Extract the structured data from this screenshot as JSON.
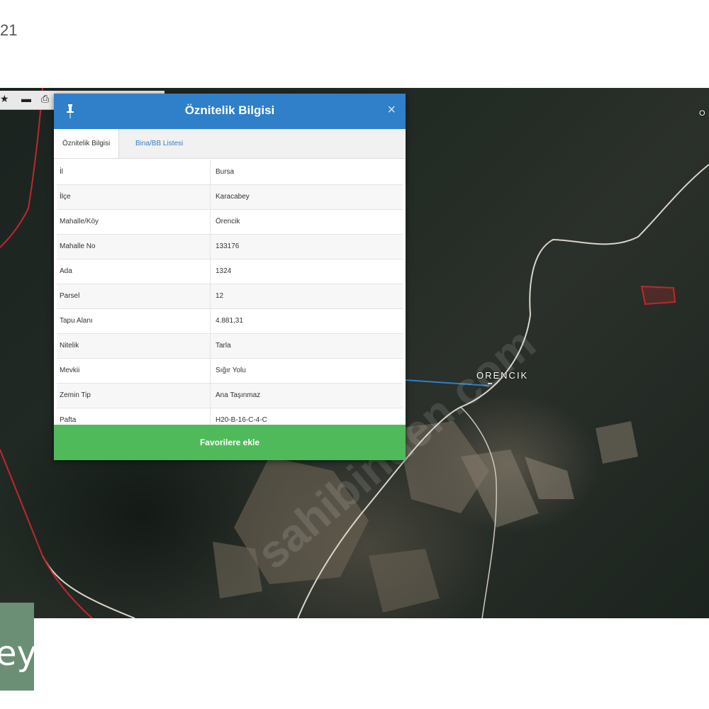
{
  "page_number": "21",
  "map": {
    "village_label": "ORENCIK",
    "road_tag": "",
    "top_right_label": "O",
    "parcel_label": ""
  },
  "panel": {
    "title": "Öznitelik Bilgisi",
    "close_symbol": "×",
    "tabs": [
      {
        "label": "Öznitelik Bilgisi",
        "active": true
      },
      {
        "label": "Bina/BB Listesi",
        "active": false
      }
    ],
    "rows": [
      {
        "key": "İl",
        "value": "Bursa"
      },
      {
        "key": "İlçe",
        "value": "Karacabey"
      },
      {
        "key": "Mahalle/Köy",
        "value": "Örencik"
      },
      {
        "key": "Mahalle No",
        "value": "133176"
      },
      {
        "key": "Ada",
        "value": "1324"
      },
      {
        "key": "Parsel",
        "value": "12"
      },
      {
        "key": "Tapu Alanı",
        "value": "4.881,31"
      },
      {
        "key": "Nitelik",
        "value": "Tarla"
      },
      {
        "key": "Mevkii",
        "value": "Sığır Yolu"
      },
      {
        "key": "Zemin Tip",
        "value": "Ana Taşınmaz"
      },
      {
        "key": "Pafta",
        "value": "H20-B-16-C-4-C"
      }
    ],
    "button_label": "Favorilere ekle"
  },
  "logo_text": "ey",
  "colors": {
    "header": "#2f7fc9",
    "button": "#4fba5a",
    "boundary": "#c0272d",
    "road": "#d9d4c8"
  }
}
